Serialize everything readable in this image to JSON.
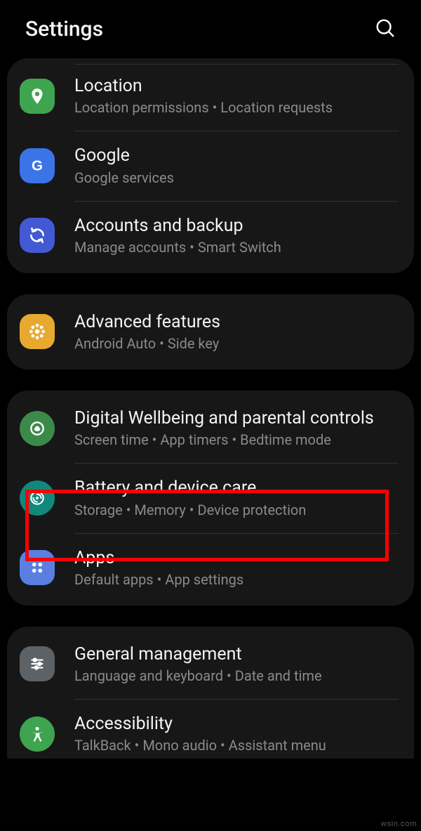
{
  "header": {
    "title": "Settings"
  },
  "groups": [
    {
      "items": [
        {
          "key": "location",
          "title": "Location",
          "subtitle": "Location permissions  •  Location requests",
          "icon": "location-pin-icon",
          "bg": "#3fa44f"
        },
        {
          "key": "google",
          "title": "Google",
          "subtitle": "Google services",
          "icon": "google-icon",
          "bg": "#3b74e7"
        },
        {
          "key": "accounts",
          "title": "Accounts and backup",
          "subtitle": "Manage accounts  •  Smart Switch",
          "icon": "sync-icon",
          "bg": "#4359d4"
        }
      ]
    },
    {
      "items": [
        {
          "key": "advanced",
          "title": "Advanced features",
          "subtitle": "Android Auto  •  Side key",
          "icon": "gear-flower-icon",
          "bg": "#e8a92f"
        }
      ]
    },
    {
      "items": [
        {
          "key": "wellbeing",
          "title": "Digital Wellbeing and parental controls",
          "subtitle": "Screen time  •  App timers  •  Bedtime mode",
          "icon": "wellbeing-icon",
          "bg": "#3c8a4a"
        },
        {
          "key": "battery",
          "title": "Battery and device care",
          "subtitle": "Storage  •  Memory  •  Device protection",
          "icon": "device-care-icon",
          "bg": "#11887b",
          "highlighted": true
        },
        {
          "key": "apps",
          "title": "Apps",
          "subtitle": "Default apps  •  App settings",
          "icon": "apps-grid-icon",
          "bg": "#5a7fe0"
        }
      ]
    },
    {
      "items": [
        {
          "key": "general",
          "title": "General management",
          "subtitle": "Language and keyboard  •  Date and time",
          "icon": "sliders-icon",
          "bg": "#5d6267"
        },
        {
          "key": "accessibility",
          "title": "Accessibility",
          "subtitle": "TalkBack  •  Mono audio  •  Assistant menu",
          "icon": "accessibility-icon",
          "bg": "#3fa44f"
        }
      ]
    }
  ],
  "watermark": "wsin.com"
}
